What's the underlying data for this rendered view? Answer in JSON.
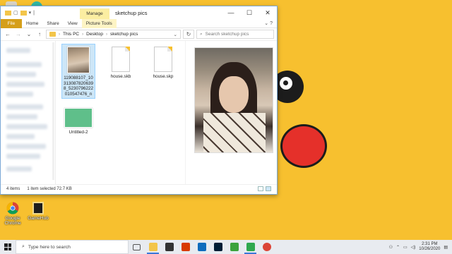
{
  "window": {
    "title": "sketchup pics",
    "contextual_tab": "Manage",
    "controls": {
      "minimize": "—",
      "maximize": "☐",
      "close": "✕"
    }
  },
  "ribbon": {
    "tabs": [
      "File",
      "Home",
      "Share",
      "View",
      "Picture Tools"
    ]
  },
  "address": {
    "segments": [
      "This PC",
      "Desktop",
      "sketchup pics"
    ],
    "search_placeholder": "Search sketchup pics"
  },
  "files": [
    {
      "name": "119088107_103130878206398_5230796222010547476_n",
      "type": "image",
      "selected": true
    },
    {
      "name": "house.skb",
      "type": "document",
      "selected": false
    },
    {
      "name": "house.skp",
      "type": "document",
      "selected": false
    },
    {
      "name": "Untitled-2",
      "type": "image-green",
      "selected": false
    }
  ],
  "status": {
    "item_count": "4 items",
    "selection": "1 item selected  72.7 KB"
  },
  "desktop_shortcuts": [
    {
      "label": "Google Chrome",
      "icon": "chrome-icon"
    },
    {
      "label": "GameHub",
      "icon": "file-icon"
    }
  ],
  "taskbar": {
    "search_placeholder": "Type here to search",
    "apps": [
      {
        "name": "task-view-icon",
        "color": "#555555"
      },
      {
        "name": "file-explorer-icon",
        "color": "#f3c54a"
      },
      {
        "name": "store-icon",
        "color": "#333333"
      },
      {
        "name": "office-icon",
        "color": "#d83b01"
      },
      {
        "name": "mail-icon",
        "color": "#0f6cbd"
      },
      {
        "name": "photoshop-icon",
        "color": "#001e36"
      },
      {
        "name": "camtasia-icon",
        "color": "#3ca33c"
      },
      {
        "name": "camtasia-recorder-icon",
        "color": "#2fa84f"
      },
      {
        "name": "chrome-icon",
        "color": "#db4437"
      }
    ],
    "time": "2:31 PM",
    "date": "10/26/2020"
  }
}
